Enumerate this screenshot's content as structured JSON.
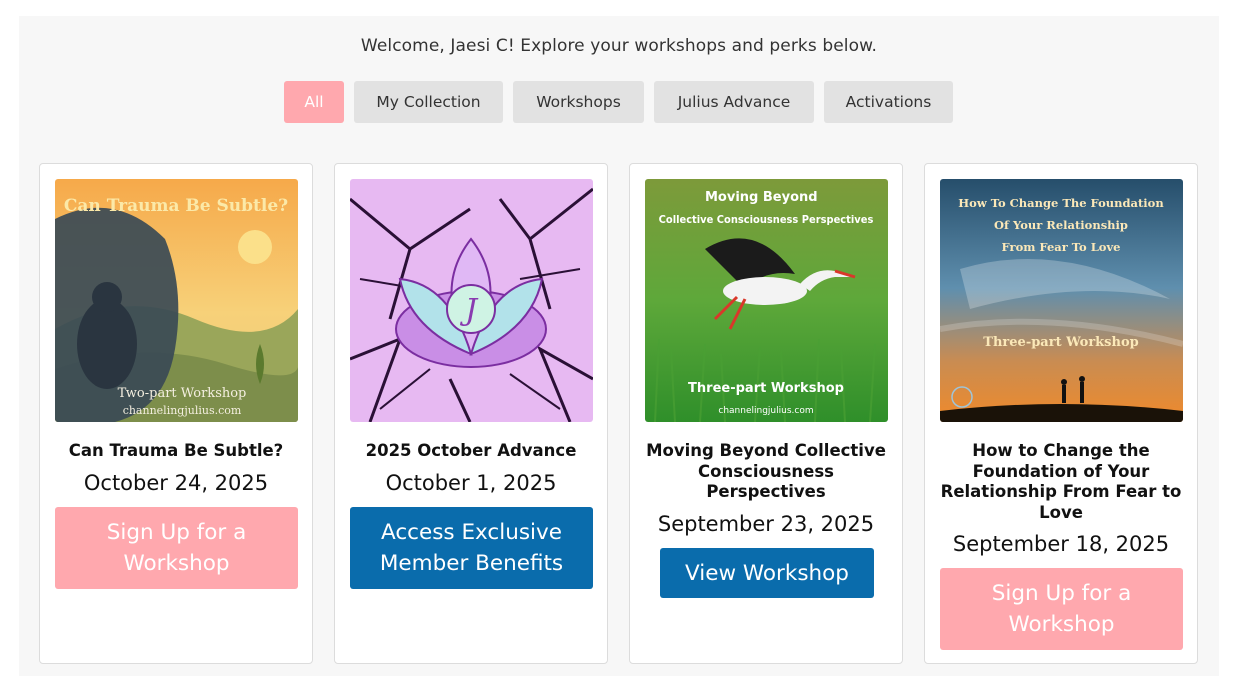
{
  "welcome": "Welcome, Jaesi C! Explore your workshops and perks below.",
  "colors": {
    "accent_pink": "#ffa8ae",
    "primary_blue": "#0a6cac",
    "tab_gray": "#e2e2e2"
  },
  "tabs": [
    {
      "label": "All",
      "active": true
    },
    {
      "label": "My Collection",
      "active": false
    },
    {
      "label": "Workshops",
      "active": false
    },
    {
      "label": "Julius Advance",
      "active": false
    },
    {
      "label": "Activations",
      "active": false
    }
  ],
  "cards": [
    {
      "image": {
        "heading": "Can Trauma Be Subtle?",
        "caption": "Two-part Workshop",
        "site": "channelingjulius.com",
        "icon": "trauma-artwork"
      },
      "title": "Can Trauma Be Subtle?",
      "date": "October 24, 2025",
      "button": "Sign Up for a Workshop"
    },
    {
      "image": {
        "monogram": "J",
        "icon": "lotus-artwork"
      },
      "title": "2025 October Advance",
      "date": "October 1, 2025",
      "button": "Access Exclusive Member Benefits"
    },
    {
      "image": {
        "heading_line1": "Moving Beyond",
        "heading_line2": "Collective Consciousness Perspectives",
        "caption": "Three-part Workshop",
        "site": "channelingjulius.com",
        "icon": "stork-artwork"
      },
      "title": "Moving Beyond Collective Consciousness Perspectives",
      "date": "September 23, 2025",
      "button": "View Workshop"
    },
    {
      "image": {
        "heading_line1": "How To Change The Foundation",
        "heading_line2": "Of Your Relationship",
        "heading_line3": "From Fear To Love",
        "caption": "Three-part Workshop",
        "icon": "sunset-couple-artwork"
      },
      "title": "How to Change the Foundation of Your Relationship From Fear to Love",
      "date": "September 18, 2025",
      "button": "Sign Up for a Workshop"
    }
  ]
}
